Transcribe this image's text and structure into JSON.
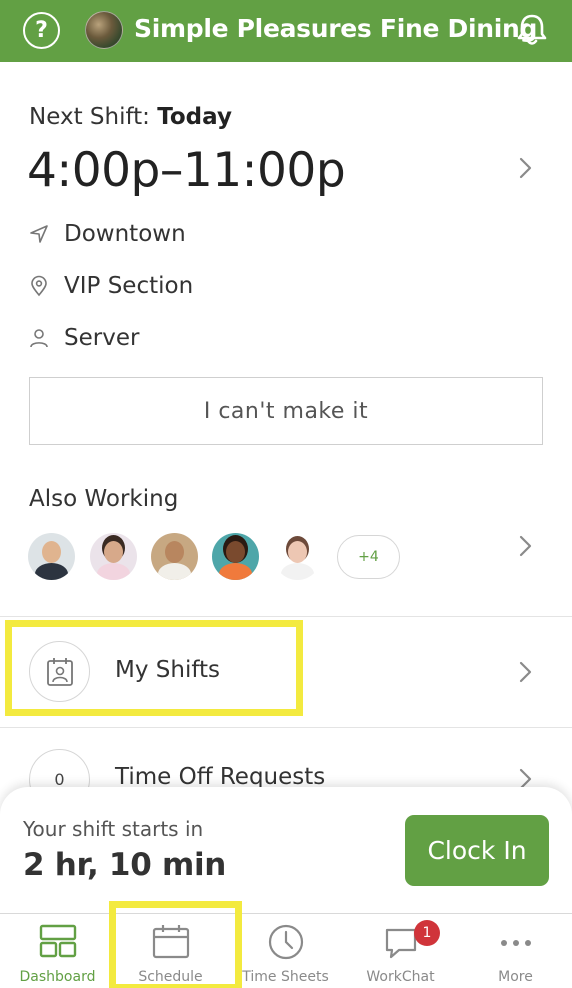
{
  "header": {
    "help_icon": "question-circle-icon",
    "venue_name": "Simple Pleasures Fine Dining",
    "notifications_icon": "bell-icon",
    "brand_color": "#62a044"
  },
  "next_shift": {
    "label_prefix": "Next Shift:",
    "label_day": "Today",
    "time_range": "4:00p–11:00p",
    "location": "Downtown",
    "section": "VIP Section",
    "role": "Server",
    "cant_make_it_label": "I can't make it"
  },
  "also_working": {
    "title": "Also Working",
    "more_count": "+4"
  },
  "rows": {
    "my_shifts_label": "My Shifts",
    "time_off_count": "0",
    "time_off_label": "Time Off Requests"
  },
  "clock_sheet": {
    "caption": "Your shift starts in",
    "countdown": "2 hr, 10 min",
    "clock_in_label": "Clock In"
  },
  "tabs": [
    {
      "label": "Dashboard",
      "icon": "dashboard-icon",
      "active": true
    },
    {
      "label": "Schedule",
      "icon": "calendar-icon",
      "active": false
    },
    {
      "label": "Time Sheets",
      "icon": "clock-icon",
      "active": false
    },
    {
      "label": "WorkChat",
      "icon": "chat-icon",
      "active": false,
      "badge": "1"
    },
    {
      "label": "More",
      "icon": "more-dots-icon",
      "active": false
    }
  ],
  "colors": {
    "accent": "#62a044",
    "badge": "#d0343a",
    "highlight": "#f3ea3f"
  }
}
